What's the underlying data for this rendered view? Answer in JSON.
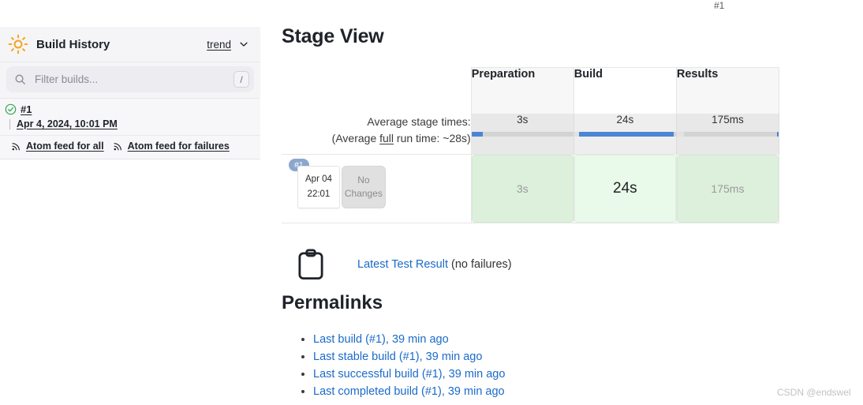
{
  "top_build_number": "#1",
  "sidebar": {
    "header": {
      "icon": "sun-icon",
      "title": "Build History",
      "trend_label": "trend",
      "chevron": "chevron-down-icon"
    },
    "filter": {
      "icon": "search-icon",
      "placeholder": "Filter builds...",
      "value": "",
      "shortcut_key": "/"
    },
    "build": {
      "status_icon": "circle-check-icon",
      "number": "#1",
      "timestamp": "Apr 4, 2024, 10:01 PM"
    },
    "feeds": [
      {
        "icon": "rss-icon",
        "label": "Atom feed for all"
      },
      {
        "icon": "rss-icon",
        "label": "Atom feed for failures"
      }
    ]
  },
  "main": {
    "page_title": "Stage View",
    "stage_view": {
      "stages": [
        "Preparation",
        "Build",
        "Results"
      ],
      "hovered_stage_index": 1,
      "average_label_line1": "Average stage times:",
      "average_label_line2_prefix": "(Average ",
      "average_label_underlined": "full",
      "average_label_line2_suffix": " run time: ~28s)",
      "average_times": [
        "3s",
        "24s",
        "175ms"
      ],
      "average_bars": [
        {
          "pre_pct": 0,
          "fill_left_pct": 0,
          "fill_pct": 11
        },
        {
          "pre_pct": 5,
          "fill_left_pct": 5,
          "fill_pct": 93
        },
        {
          "pre_pct": 7,
          "fill_left_pct": 98.5,
          "fill_pct": 1.5
        }
      ],
      "build_row": {
        "bubble": "#1",
        "date": "Apr 04",
        "time": "22:01",
        "changes": "No Changes"
      },
      "stage_results": [
        "3s",
        "24s",
        "175ms"
      ]
    },
    "test_result": {
      "icon": "clipboard-icon",
      "link_label": "Latest Test Result",
      "suffix": " (no failures)"
    },
    "permalinks": {
      "title": "Permalinks",
      "items": [
        "Last build (#1), 39 min ago",
        "Last stable build (#1), 39 min ago",
        "Last successful build (#1), 39 min ago",
        "Last completed build (#1), 39 min ago"
      ]
    }
  },
  "watermark": "CSDN @endswel",
  "colors": {
    "link": "#1b6ac9",
    "bar_fill": "#4a86d4",
    "stage_success": "#ddf0dc",
    "stage_success_hover": "#e9faea",
    "sun": "#f5a623",
    "status_ok": "#2ea44f",
    "bubble": "#8ba7cd"
  }
}
